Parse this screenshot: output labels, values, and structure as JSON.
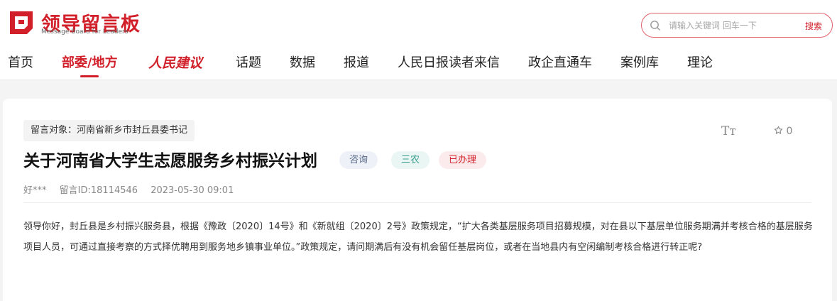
{
  "brand": {
    "title": "领导留言板",
    "subtitle": "Message Board for Leaders",
    "accent_color": "#d2202a"
  },
  "search": {
    "placeholder": "请输入关键词 回车一下",
    "button_label": "搜索",
    "icon": "search-icon"
  },
  "nav": {
    "items": [
      {
        "label": "首页"
      },
      {
        "label": "部委/地方",
        "active": true
      },
      {
        "label": "人民建议"
      },
      {
        "label": "话题"
      },
      {
        "label": "数据"
      },
      {
        "label": "报道"
      },
      {
        "label": "人民日报读者来信"
      },
      {
        "label": "政企直通车"
      },
      {
        "label": "案例库"
      },
      {
        "label": "理论"
      }
    ]
  },
  "message": {
    "target": "留言对象：河南省新乡市封丘县委书记",
    "title": "关于河南省大学生志愿服务乡村振兴计划",
    "tags": {
      "type": "咨询",
      "category": "三农",
      "status": "已办理"
    },
    "font_size_icon": "Tт",
    "favorite_icon": "star-outline-icon",
    "favorite_count": "0",
    "author": "好***",
    "message_id": "留言ID:18114546",
    "datetime": "2023-05-30 09:01",
    "body": "领导你好，封丘县是乡村振兴服务县，根据《豫政〔2020〕14号》和《新就组〔2020〕2号》政策规定，“扩大各类基层服务项目招募规模，对在县以下基层单位服务期满并考核合格的基层服务项目人员，可通过直接考察的方式择优聘用到服务地乡镇事业单位。”政策规定，请问期满后有没有机会留任基层岗位，或者在当地县内有空闲编制考核合格进行转正呢?"
  }
}
